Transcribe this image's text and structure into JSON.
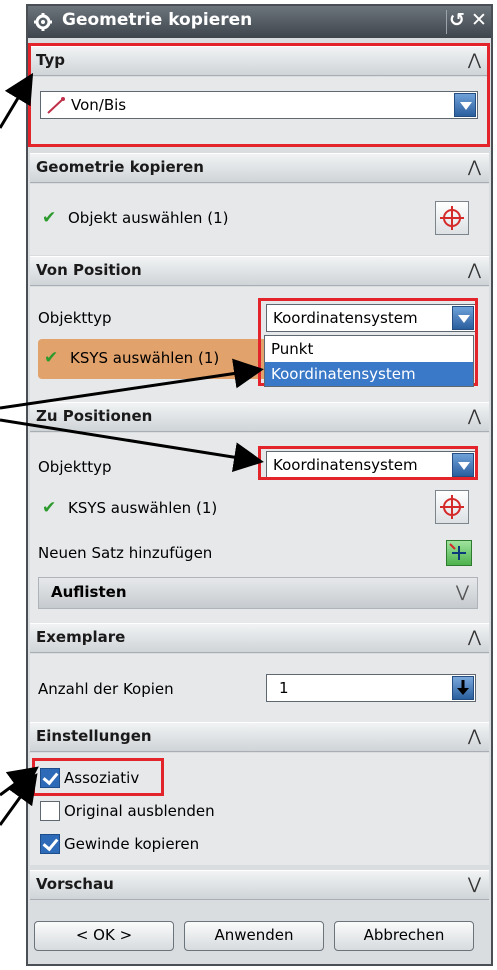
{
  "window": {
    "title": "Geometrie kopieren"
  },
  "sections": {
    "typ": {
      "label": "Typ",
      "value": "Von/Bis"
    },
    "geometrie": {
      "label": "Geometrie kopieren",
      "select_label": "Objekt auswählen (1)"
    },
    "von_position": {
      "label": "Von Position",
      "objekttyp_label": "Objekttyp",
      "objekttyp_value": "Koordinatensystem",
      "select_label": "KSYS auswählen (1)",
      "dropdown_options": [
        "Punkt",
        "Koordinatensystem"
      ],
      "dropdown_selected": "Koordinatensystem"
    },
    "zu_positionen": {
      "label": "Zu Positionen",
      "objekttyp_label": "Objekttyp",
      "objekttyp_value": "Koordinatensystem",
      "select_label": "KSYS auswählen (1)",
      "new_set_label": "Neuen Satz hinzufügen",
      "list_label": "Auflisten"
    },
    "exemplare": {
      "label": "Exemplare",
      "count_label": "Anzahl der Kopien",
      "count_value": "1"
    },
    "einstellungen": {
      "label": "Einstellungen",
      "options": [
        {
          "label": "Assoziativ",
          "checked": true
        },
        {
          "label": "Original ausblenden",
          "checked": false
        },
        {
          "label": "Gewinde kopieren",
          "checked": true
        }
      ]
    },
    "vorschau": {
      "label": "Vorschau"
    }
  },
  "buttons": {
    "ok": "< OK >",
    "apply": "Anwenden",
    "cancel": "Abbrechen"
  },
  "colors": {
    "highlight": "#e3242b",
    "selection": "#3a78c8",
    "checkmark": "#2d9a2d",
    "selected_field": "#e2a26c"
  }
}
